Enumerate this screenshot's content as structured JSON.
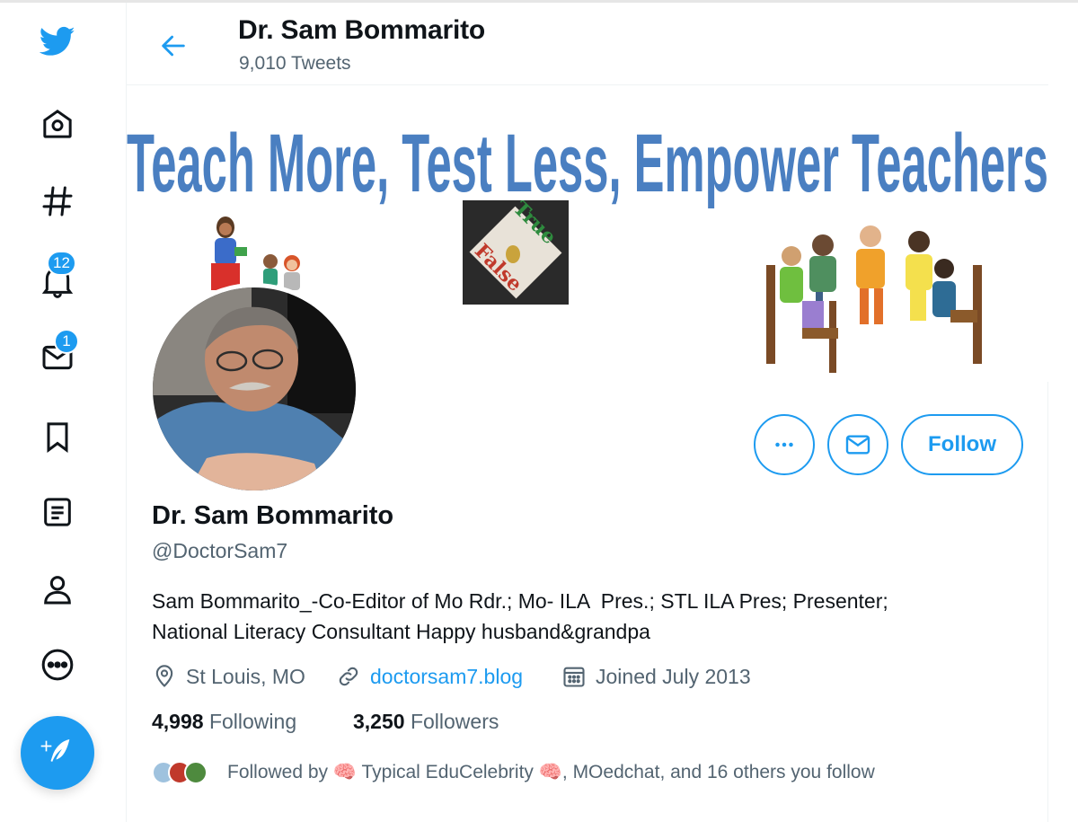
{
  "header": {
    "name": "Dr. Sam Bommarito",
    "tweet_count": "9,010 Tweets"
  },
  "nav": {
    "icons": [
      "twitter-logo-icon",
      "home-icon",
      "explore-hashtag-icon",
      "notifications-bell-icon",
      "messages-envelope-icon",
      "bookmarks-icon",
      "lists-icon",
      "profile-icon",
      "more-icon",
      "compose-tweet-icon"
    ],
    "notifications_badge": "12",
    "messages_badge": "1"
  },
  "banner": {
    "headline": "Teach More, Test Less, Empower Teachers",
    "card_true": "True",
    "card_false": "False"
  },
  "profile": {
    "name": "Dr. Sam Bommarito",
    "handle": "@DoctorSam7",
    "bio": "Sam Bommarito_-Co-Editor of Mo Rdr.; Mo- ILA  Pres.; STL ILA Pres; Presenter;\nNational Literacy Consultant Happy husband&grandpa",
    "location": "St Louis, MO",
    "website": "doctorsam7.blog",
    "joined": "Joined July 2013",
    "following_count": "4,998",
    "following_label": "Following",
    "followers_count": "3,250",
    "followers_label": "Followers",
    "followed_by": "Followed by 🧠 Typical EduCelebrity 🧠, MOedchat, and 16 others you follow"
  },
  "actions": {
    "more_icon": "more-horizontal-icon",
    "message_icon": "envelope-icon",
    "follow_label": "Follow"
  },
  "colors": {
    "accent": "#1d9bf0",
    "text_primary": "#0f1419",
    "text_secondary": "#536471",
    "banner_text": "#4a7fc1"
  }
}
